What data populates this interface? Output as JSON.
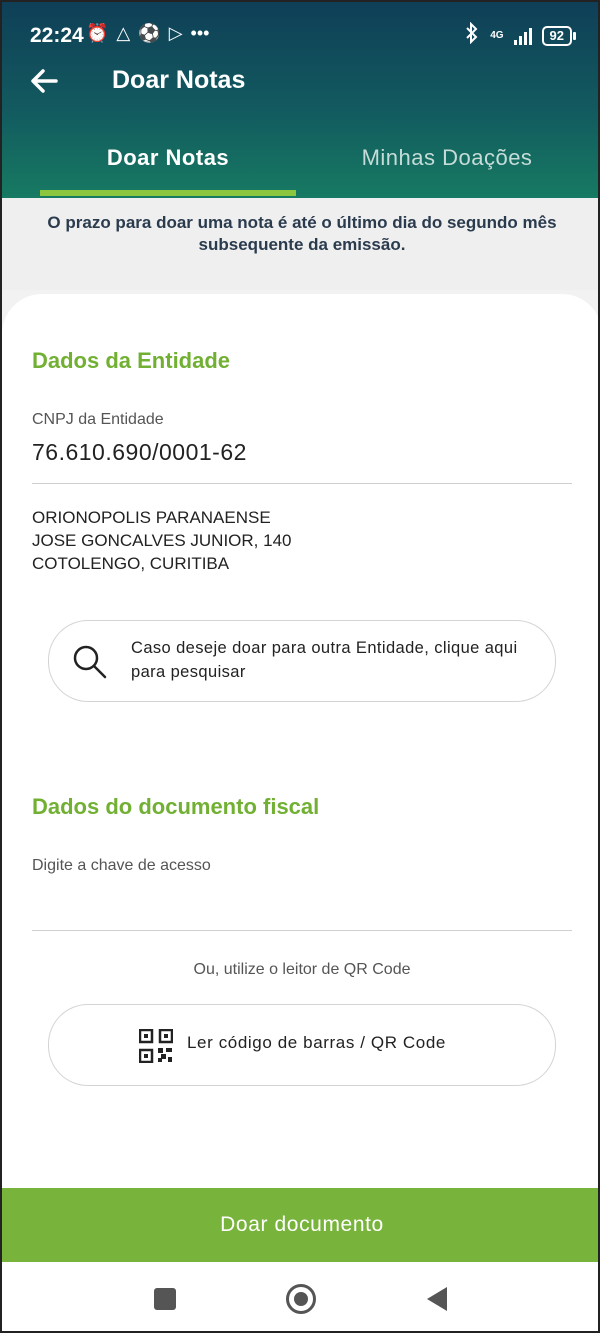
{
  "status_bar": {
    "time": "22:24",
    "network": "4G",
    "battery": "92"
  },
  "app_bar": {
    "title": "Doar Notas"
  },
  "tabs": [
    {
      "label": "Doar Notas",
      "active": true
    },
    {
      "label": "Minhas Doações",
      "active": false
    }
  ],
  "notice": "O prazo para doar uma nota é até o último dia do segundo mês subsequente da emissão.",
  "entity": {
    "section_title": "Dados da Entidade",
    "cnpj_label": "CNPJ da Entidade",
    "cnpj_value": "76.610.690/0001-62",
    "address_lines": [
      "ORIONOPOLIS PARANAENSE",
      "JOSE GONCALVES JUNIOR, 140",
      "COTOLENGO, CURITIBA"
    ],
    "search_prompt": "Caso deseje doar para outra Entidade, clique aqui para pesquisar"
  },
  "fiscal": {
    "section_title": "Dados do documento fiscal",
    "access_key_placeholder": "Digite a chave de acesso",
    "access_key_value": "",
    "or_text": "Ou, utilize o leitor de QR Code",
    "qr_button_label": "Ler código de barras / QR Code"
  },
  "donate_button_label": "Doar documento",
  "colors": {
    "accent_green": "#78b43b",
    "section_green": "#72b034",
    "header_dark": "#0f3f57",
    "header_teal": "#177a62"
  }
}
